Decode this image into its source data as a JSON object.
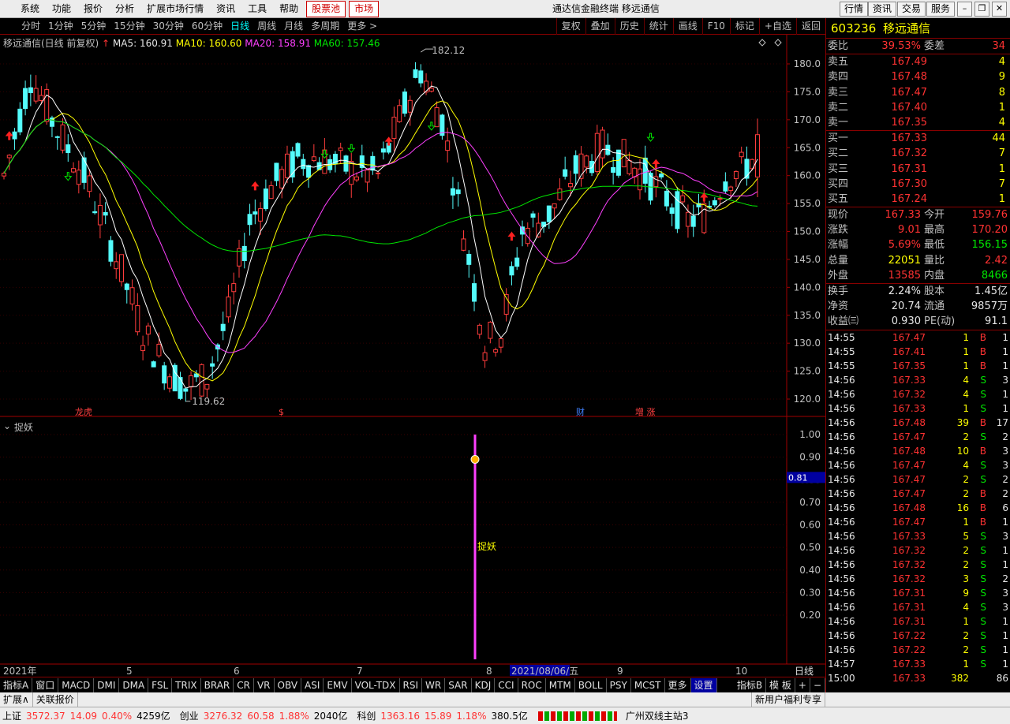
{
  "menu": {
    "items": [
      "系统",
      "功能",
      "报价",
      "分析",
      "扩展市场行情",
      "资讯",
      "工具",
      "帮助"
    ],
    "stock_pool": "股票池",
    "market": "市场",
    "title": "通达信金融终端  移远通信",
    "right_buttons": [
      "行情",
      "资讯",
      "交易",
      "服务"
    ]
  },
  "periods": [
    "分时",
    "1分钟",
    "5分钟",
    "15分钟",
    "30分钟",
    "60分钟",
    "日线",
    "周线",
    "月线",
    "多周期",
    "更多 >"
  ],
  "active_period": "日线",
  "right_tools": [
    "复权",
    "叠加",
    "历史",
    "统计",
    "画线",
    "F10",
    "标记",
    "+自选",
    "返回"
  ],
  "info": {
    "name": "移远通信(日线 前复权)",
    "ma5": "MA5: 160.91",
    "ma10": "MA10: 160.60",
    "ma20": "MA20: 158.91",
    "ma60": "MA60: 157.46"
  },
  "indicator": {
    "name": "捉妖",
    "label": "捉妖",
    "current": "0.81"
  },
  "price_axis": [
    "180.0",
    "175.0",
    "170.0",
    "165.0",
    "160.0",
    "155.0",
    "150.0",
    "145.0",
    "140.0",
    "135.0",
    "130.0",
    "125.0",
    "120.0"
  ],
  "ind_axis": [
    "1.00",
    "0.90",
    "0.80",
    "0.70",
    "0.60",
    "0.50",
    "0.40",
    "0.30",
    "0.20"
  ],
  "annotations": {
    "high": "182.12",
    "low": "119.62"
  },
  "markers": [
    {
      "text": "龙虎"
    },
    {
      "text": "$"
    },
    {
      "text": "财"
    },
    {
      "text": "增 涨"
    }
  ],
  "date_axis": [
    "2021年",
    "5",
    "6",
    "7",
    "8",
    "2021/08/06/五",
    "9",
    "10"
  ],
  "date_axis_right": "日线",
  "chart_data": {
    "type": "candlestick",
    "title": "移远通信(日线 前复权)",
    "ylim": [
      117,
      183
    ],
    "highlights": {
      "high": 182.12,
      "low": 119.62,
      "indicator_value": 0.81,
      "indicator_date": "2021/08/06"
    },
    "series_names": [
      "MA5",
      "MA10",
      "MA20",
      "MA60"
    ]
  },
  "bottom_tabs": [
    "指标A",
    "窗口",
    "MACD",
    "DMI",
    "DMA",
    "FSL",
    "TRIX",
    "BRAR",
    "CR",
    "VR",
    "OBV",
    "ASI",
    "EMV",
    "VOL-TDX",
    "RSI",
    "WR",
    "SAR",
    "KDJ",
    "CCI",
    "ROC",
    "MTM",
    "BOLL",
    "PSY",
    "MCST",
    "更多",
    "设置"
  ],
  "bottom_right": [
    "指标B",
    "模 板",
    "+",
    "−"
  ],
  "bottom2": {
    "left": [
      "扩展∧",
      "关联报价"
    ],
    "right": "新用户福利专享"
  },
  "status": {
    "sh_name": "上证",
    "sh": "3572.37",
    "sh_chg": "14.09",
    "sh_pct": "0.40%",
    "sh_amt": "4259亿",
    "cy_name": "创业",
    "cy": "3276.32",
    "cy_chg": "60.58",
    "cy_pct": "1.88%",
    "cy_amt": "2040亿",
    "kc_name": "科创",
    "kc": "1363.16",
    "kc_chg": "15.89",
    "kc_pct": "1.18%",
    "kc_amt": "380.5亿",
    "site": "广州双线主站3"
  },
  "quote": {
    "code": "603236",
    "name": "移远通信",
    "wb": {
      "l1": "委比",
      "v1": "39.53%",
      "l2": "委差",
      "v2": "34"
    },
    "sells": [
      {
        "l": "卖五",
        "p": "167.49",
        "v": "4"
      },
      {
        "l": "卖四",
        "p": "167.48",
        "v": "9"
      },
      {
        "l": "卖三",
        "p": "167.47",
        "v": "8"
      },
      {
        "l": "卖二",
        "p": "167.40",
        "v": "1"
      },
      {
        "l": "卖一",
        "p": "167.35",
        "v": "4"
      }
    ],
    "buys": [
      {
        "l": "买一",
        "p": "167.33",
        "v": "44"
      },
      {
        "l": "买二",
        "p": "167.32",
        "v": "7"
      },
      {
        "l": "买三",
        "p": "167.31",
        "v": "1"
      },
      {
        "l": "买四",
        "p": "167.30",
        "v": "7"
      },
      {
        "l": "买五",
        "p": "167.24",
        "v": "1"
      }
    ],
    "stats": [
      {
        "l1": "现价",
        "v1": "167.33",
        "l2": "今开",
        "v2": "159.76"
      },
      {
        "l1": "涨跌",
        "v1": "9.01",
        "l2": "最高",
        "v2": "170.20"
      },
      {
        "l1": "涨幅",
        "v1": "5.69%",
        "l2": "最低",
        "v2": "156.15"
      },
      {
        "l1": "总量",
        "v1": "22051",
        "l2": "量比",
        "v2": "2.42"
      },
      {
        "l1": "外盘",
        "v1": "13585",
        "l2": "内盘",
        "v2": "8466"
      }
    ],
    "stats2": [
      {
        "l1": "换手",
        "v1": "2.24%",
        "l2": "股本",
        "v2": "1.45亿"
      },
      {
        "l1": "净资",
        "v1": "20.74",
        "l2": "流通",
        "v2": "9857万"
      },
      {
        "l1": "收益㈢",
        "v1": "0.930",
        "l2": "PE(动)",
        "v2": "91.1"
      }
    ],
    "ticks": [
      {
        "t": "14:55",
        "p": "167.47",
        "v": "1",
        "s": "B",
        "n": "1"
      },
      {
        "t": "14:55",
        "p": "167.41",
        "v": "1",
        "s": "B",
        "n": "1"
      },
      {
        "t": "14:55",
        "p": "167.35",
        "v": "1",
        "s": "B",
        "n": "1"
      },
      {
        "t": "14:56",
        "p": "167.33",
        "v": "4",
        "s": "S",
        "n": "3"
      },
      {
        "t": "14:56",
        "p": "167.32",
        "v": "4",
        "s": "S",
        "n": "1"
      },
      {
        "t": "14:56",
        "p": "167.33",
        "v": "1",
        "s": "S",
        "n": "1"
      },
      {
        "t": "14:56",
        "p": "167.48",
        "v": "39",
        "s": "B",
        "n": "17"
      },
      {
        "t": "14:56",
        "p": "167.47",
        "v": "2",
        "s": "S",
        "n": "2"
      },
      {
        "t": "14:56",
        "p": "167.48",
        "v": "10",
        "s": "B",
        "n": "3"
      },
      {
        "t": "14:56",
        "p": "167.47",
        "v": "4",
        "s": "S",
        "n": "3"
      },
      {
        "t": "14:56",
        "p": "167.47",
        "v": "2",
        "s": "S",
        "n": "2"
      },
      {
        "t": "14:56",
        "p": "167.47",
        "v": "2",
        "s": "B",
        "n": "2"
      },
      {
        "t": "14:56",
        "p": "167.48",
        "v": "16",
        "s": "B",
        "n": "6"
      },
      {
        "t": "14:56",
        "p": "167.47",
        "v": "1",
        "s": "B",
        "n": "1"
      },
      {
        "t": "14:56",
        "p": "167.33",
        "v": "5",
        "s": "S",
        "n": "3"
      },
      {
        "t": "14:56",
        "p": "167.32",
        "v": "2",
        "s": "S",
        "n": "1"
      },
      {
        "t": "14:56",
        "p": "167.32",
        "v": "2",
        "s": "S",
        "n": "1"
      },
      {
        "t": "14:56",
        "p": "167.32",
        "v": "3",
        "s": "S",
        "n": "2"
      },
      {
        "t": "14:56",
        "p": "167.31",
        "v": "9",
        "s": "S",
        "n": "3"
      },
      {
        "t": "14:56",
        "p": "167.31",
        "v": "4",
        "s": "S",
        "n": "3"
      },
      {
        "t": "14:56",
        "p": "167.31",
        "v": "1",
        "s": "S",
        "n": "1"
      },
      {
        "t": "14:56",
        "p": "167.22",
        "v": "2",
        "s": "S",
        "n": "1"
      },
      {
        "t": "14:56",
        "p": "167.22",
        "v": "2",
        "s": "S",
        "n": "1"
      },
      {
        "t": "14:57",
        "p": "167.33",
        "v": "1",
        "s": "S",
        "n": "1"
      },
      {
        "t": "15:00",
        "p": "167.33",
        "v": "382",
        "s": "",
        "n": "86"
      }
    ]
  }
}
